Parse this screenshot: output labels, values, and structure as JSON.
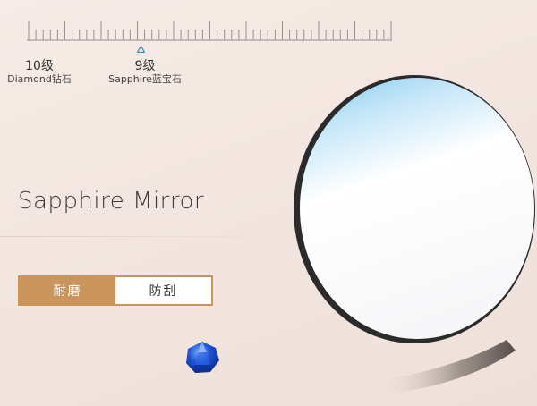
{
  "scale": {
    "labels": [
      {
        "num": "10级",
        "text": "Diamond钻石"
      },
      {
        "num": "9级",
        "text": "Sapphire蓝宝石"
      }
    ]
  },
  "title": "Sapphire Mirror",
  "tabs": [
    {
      "label": "耐磨",
      "active": true
    },
    {
      "label": "防刮",
      "active": false
    }
  ],
  "colors": {
    "accent": "#c9955d",
    "marker": "#2a8fc0"
  }
}
